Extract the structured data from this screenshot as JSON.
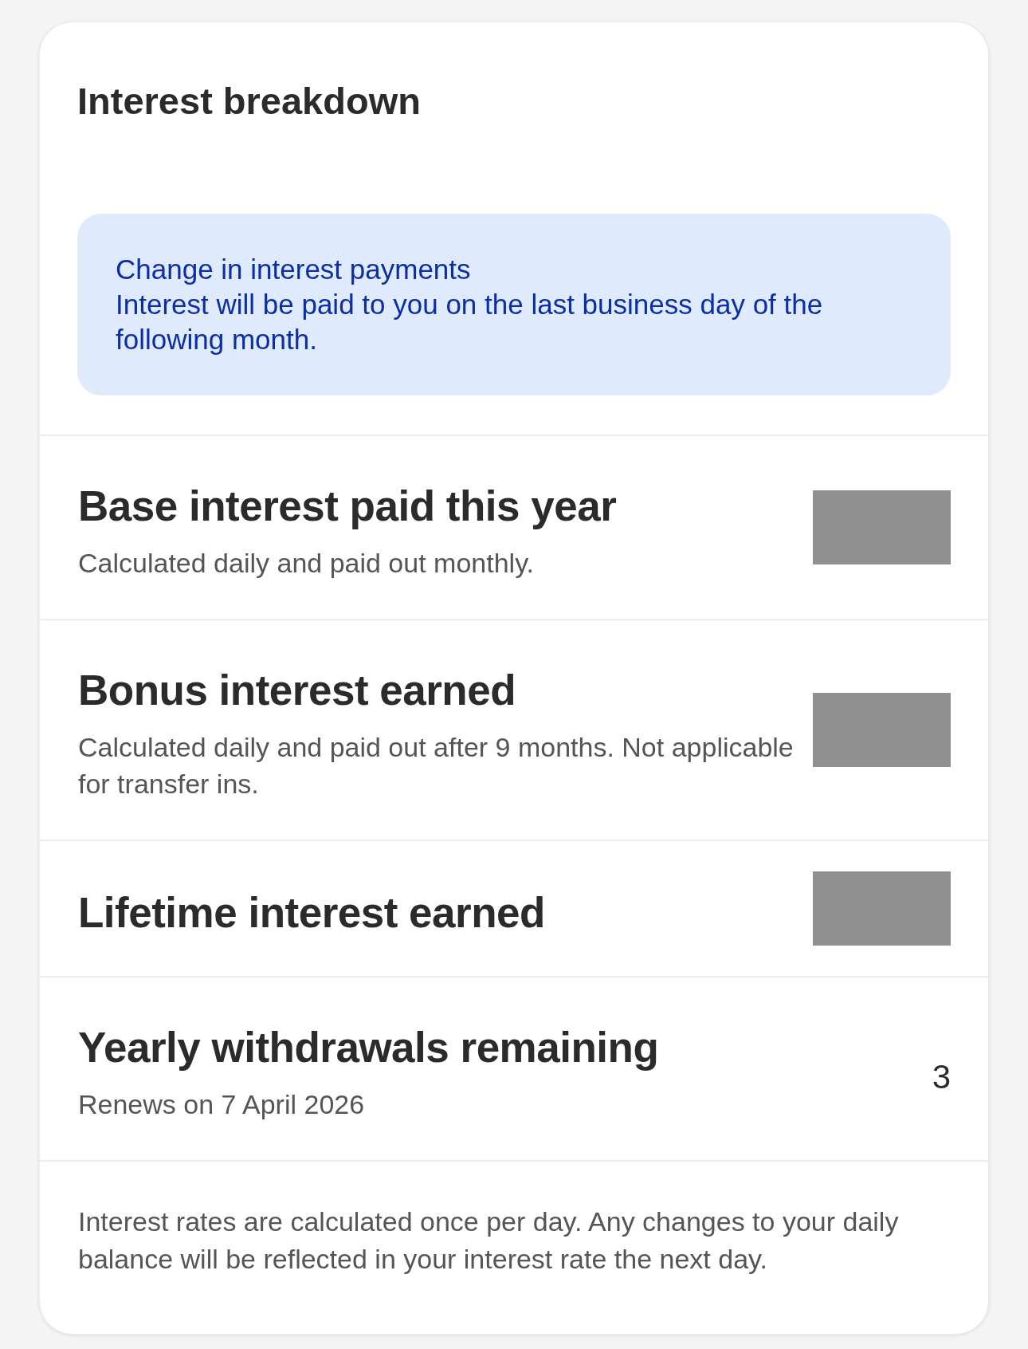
{
  "card": {
    "title": "Interest breakdown"
  },
  "notice": {
    "title": "Change in interest payments",
    "message": "Interest will be paid to you on the last business day of the following month."
  },
  "rows": [
    {
      "kind": "redacted",
      "label": "Base interest paid this year",
      "description": "Calculated daily and paid out monthly."
    },
    {
      "kind": "redacted",
      "label": "Bonus interest earned",
      "description": "Calculated daily and paid out after 9 months. Not applicable for transfer ins."
    },
    {
      "kind": "redacted",
      "label": "Lifetime interest earned"
    },
    {
      "kind": "text",
      "label": "Yearly withdrawals remaining",
      "description": "Renews on 7 April 2026",
      "value": "3"
    }
  ],
  "footnote": "Interest rates are calculated once per day. Any changes to your daily balance will be reflected in your interest rate the next day."
}
